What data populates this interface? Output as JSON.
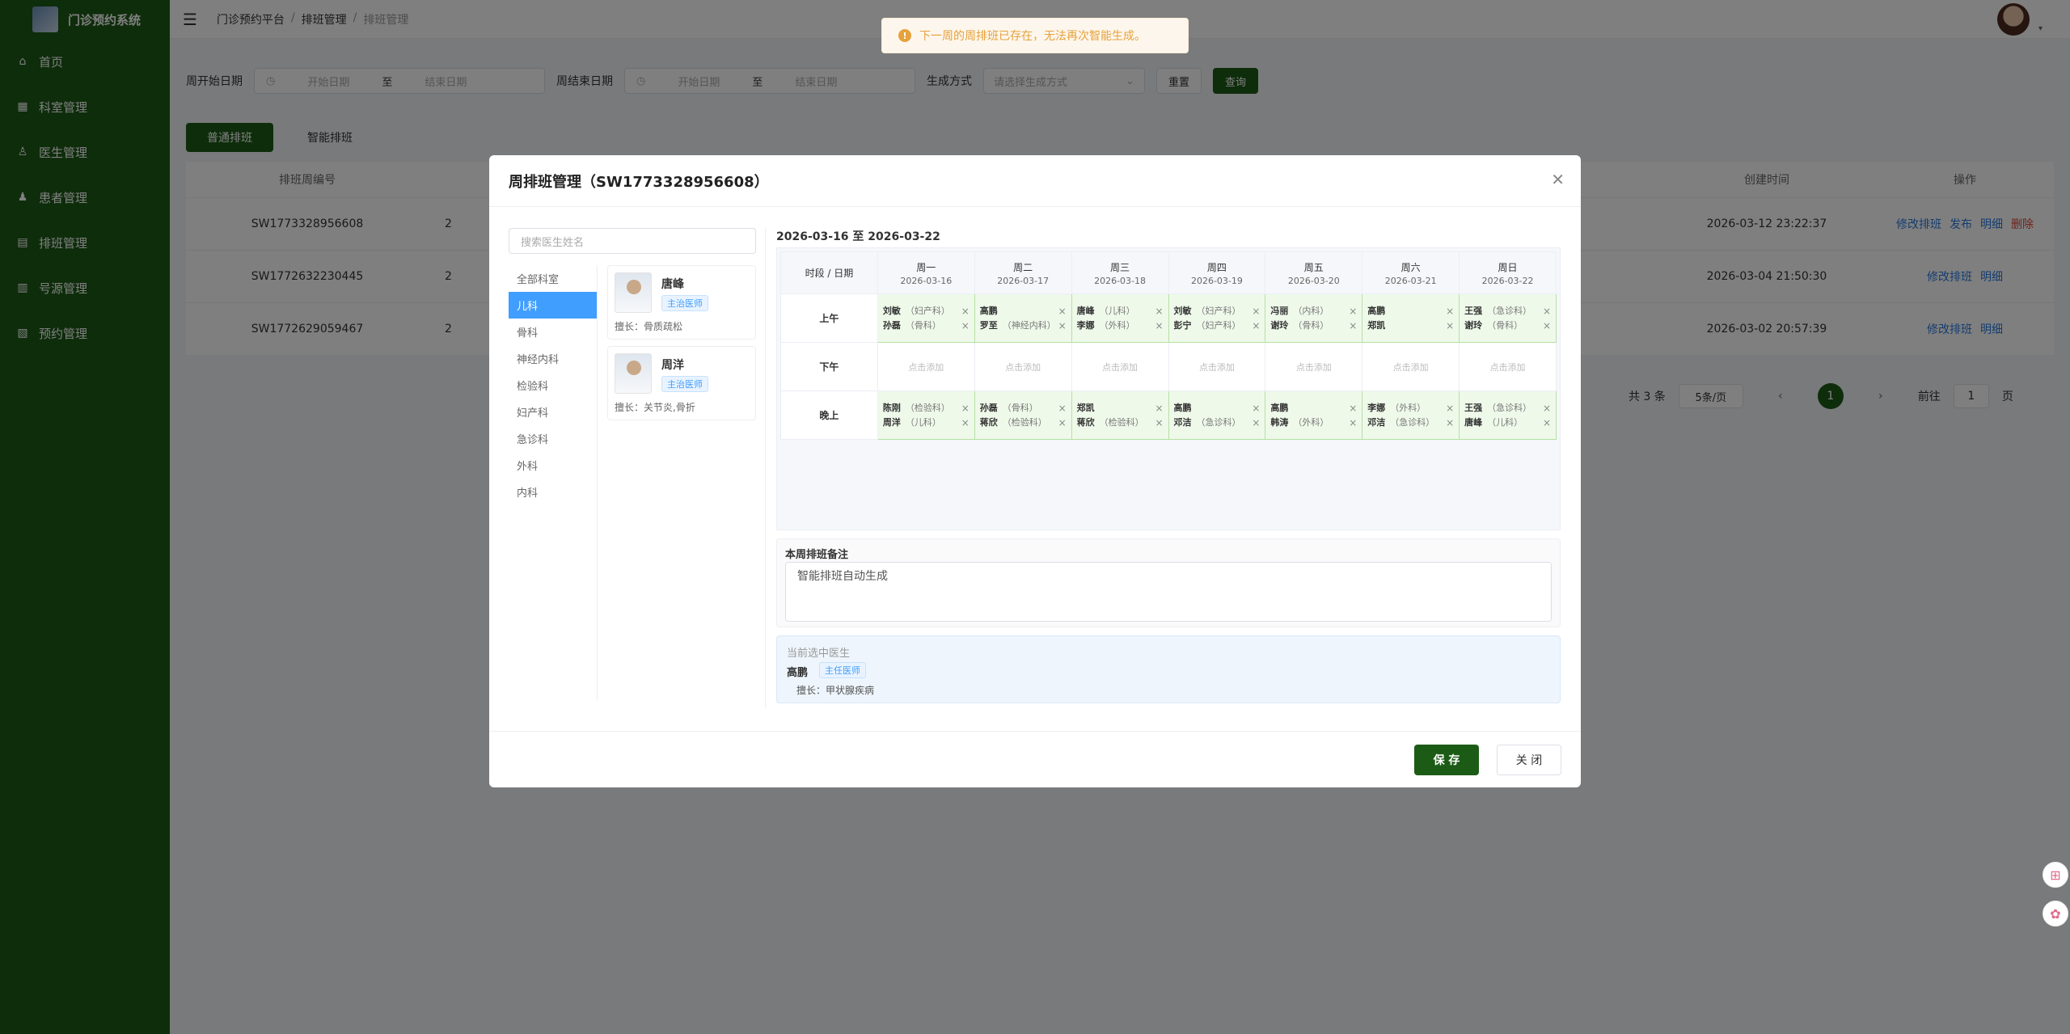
{
  "app": {
    "title": "门诊预约系统"
  },
  "sidebar": {
    "items": [
      {
        "label": "首页",
        "icon": "home-icon"
      },
      {
        "label": "科室管理",
        "icon": "grid-icon"
      },
      {
        "label": "医生管理",
        "icon": "user-icon"
      },
      {
        "label": "患者管理",
        "icon": "user-filled-icon"
      },
      {
        "label": "排班管理",
        "icon": "calendar-icon"
      },
      {
        "label": "号源管理",
        "icon": "document-icon"
      },
      {
        "label": "预约管理",
        "icon": "clipboard-icon"
      }
    ]
  },
  "breadcrumb": {
    "root": "门诊预约平台",
    "mid": "排班管理",
    "current": "排班管理"
  },
  "toast": {
    "message": "下一周的周排班已存在，无法再次智能生成。"
  },
  "filter": {
    "week_start_label": "周开始日期",
    "week_end_label": "周结束日期",
    "start_placeholder": "开始日期",
    "end_placeholder": "结束日期",
    "to": "至",
    "gen_label": "生成方式",
    "gen_placeholder": "请选择生成方式",
    "reset": "重置",
    "query": "查询"
  },
  "tabs": {
    "normal": "普通排班",
    "smart": "智能排班"
  },
  "table": {
    "headers": {
      "code": "排班周编号",
      "created": "创建时间",
      "ops": "操作"
    },
    "rows": [
      {
        "code": "SW1773328956608",
        "partial": "2",
        "created": "2026-03-12 23:22:37",
        "ops": [
          "修改排班",
          "发布",
          "明细",
          "删除"
        ]
      },
      {
        "code": "SW1772632230445",
        "partial": "2",
        "created": "2026-03-04 21:50:30",
        "ops": [
          "修改排班",
          "明细"
        ]
      },
      {
        "code": "SW1772629059467",
        "partial": "2",
        "created": "2026-03-02 20:57:39",
        "ops": [
          "修改排班",
          "明细"
        ]
      }
    ]
  },
  "pager": {
    "total": "共 3 条",
    "page_size": "5条/页",
    "current": "1",
    "goto": "前往",
    "goto_value": "1",
    "unit": "页",
    "prev": "‹",
    "next": "›"
  },
  "dialog": {
    "title": "周排班管理（SW1773328956608）",
    "search_placeholder": "搜索医生姓名",
    "departments": [
      "全部科室",
      "儿科",
      "骨科",
      "神经内科",
      "检验科",
      "妇产科",
      "急诊科",
      "外科",
      "内科"
    ],
    "active_department": "儿科",
    "doctors": [
      {
        "name": "唐峰",
        "title": "主治医师",
        "specialty": "擅长：骨质疏松"
      },
      {
        "name": "周洋",
        "title": "主治医师",
        "specialty": "擅长：关节炎,骨折"
      }
    ],
    "week_range": "2026-03-16 至 2026-03-22",
    "slot_header": "时段 / 日期",
    "days": [
      {
        "name": "周一",
        "date": "2026-03-16"
      },
      {
        "name": "周二",
        "date": "2026-03-17"
      },
      {
        "name": "周三",
        "date": "2026-03-18"
      },
      {
        "name": "周四",
        "date": "2026-03-19"
      },
      {
        "name": "周五",
        "date": "2026-03-20"
      },
      {
        "name": "周六",
        "date": "2026-03-21"
      },
      {
        "name": "周日",
        "date": "2026-03-22"
      }
    ],
    "slots": [
      {
        "name": "上午",
        "cells": [
          [
            {
              "n": "刘敏",
              "d": "（妇产科）"
            },
            {
              "n": "孙磊",
              "d": "（骨科）"
            }
          ],
          [
            {
              "n": "高鹏",
              "d": ""
            },
            {
              "n": "罗至",
              "d": "（神经内科）"
            }
          ],
          [
            {
              "n": "唐峰",
              "d": "（儿科）"
            },
            {
              "n": "李娜",
              "d": "（外科）"
            }
          ],
          [
            {
              "n": "刘敏",
              "d": "（妇产科）"
            },
            {
              "n": "彭宁",
              "d": "（妇产科）"
            }
          ],
          [
            {
              "n": "冯丽",
              "d": "（内科）"
            },
            {
              "n": "谢玲",
              "d": "（骨科）"
            }
          ],
          [
            {
              "n": "高鹏",
              "d": ""
            },
            {
              "n": "郑凯",
              "d": ""
            }
          ],
          [
            {
              "n": "王强",
              "d": "（急诊科）"
            },
            {
              "n": "谢玲",
              "d": "（骨科）"
            }
          ]
        ]
      },
      {
        "name": "下午",
        "cells": [
          [],
          [],
          [],
          [],
          [],
          [],
          []
        ]
      },
      {
        "name": "晚上",
        "cells": [
          [
            {
              "n": "陈刚",
              "d": "（检验科）"
            },
            {
              "n": "周洋",
              "d": "（儿科）"
            }
          ],
          [
            {
              "n": "孙磊",
              "d": "（骨科）"
            },
            {
              "n": "蒋欣",
              "d": "（检验科）"
            }
          ],
          [
            {
              "n": "郑凯",
              "d": ""
            },
            {
              "n": "蒋欣",
              "d": "（检验科）"
            }
          ],
          [
            {
              "n": "高鹏",
              "d": ""
            },
            {
              "n": "邓洁",
              "d": "（急诊科）"
            }
          ],
          [
            {
              "n": "高鹏",
              "d": ""
            },
            {
              "n": "韩涛",
              "d": "（外科）"
            }
          ],
          [
            {
              "n": "李娜",
              "d": "（外科）"
            },
            {
              "n": "邓洁",
              "d": "（急诊科）"
            }
          ],
          [
            {
              "n": "王强",
              "d": "（急诊科）"
            },
            {
              "n": "唐峰",
              "d": "（儿科）"
            }
          ]
        ]
      }
    ],
    "empty_cell_text": "点击添加",
    "notes_label": "本周排班备注",
    "notes_value": "智能排班自动生成",
    "selected_label": "当前选中医生",
    "selected_name": "高鹏",
    "selected_title": "主任医师",
    "selected_spec": "擅长：甲状腺疾病",
    "save": "保 存",
    "close": "关 闭"
  }
}
